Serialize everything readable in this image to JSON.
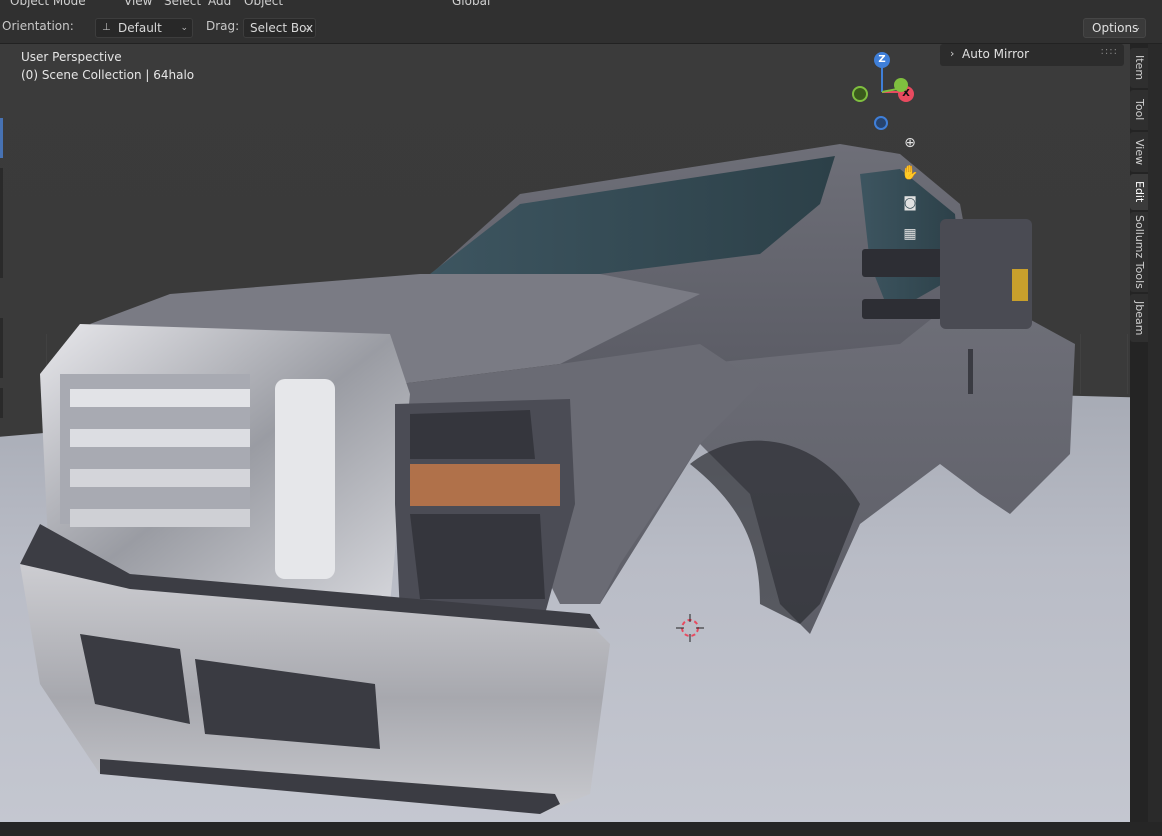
{
  "header": {
    "mode": "Object Mode",
    "menus": [
      "View",
      "Select",
      "Add",
      "Object"
    ],
    "transform_orientation": "Global"
  },
  "toolbar": {
    "orientation_label": "Orientation:",
    "orientation_value": "Default",
    "drag_label": "Drag:",
    "drag_value": "Select Box",
    "options_label": "Options"
  },
  "viewport": {
    "perspective": "User Perspective",
    "collection": "(0) Scene Collection | 64halo"
  },
  "gizmo": {
    "z": "Z",
    "x": "X"
  },
  "npanel": {
    "section": "Auto Mirror",
    "tabs": [
      "Item",
      "Tool",
      "View",
      "Edit",
      "Sollumz Tools",
      "Jbeam"
    ],
    "active_tab": "Edit"
  },
  "colors": {
    "x_axis": "#e84a5f",
    "y_axis": "#7fbf3f",
    "z_axis": "#3f7fd9",
    "active_accent": "#4772b3"
  },
  "icons": [
    "zoom-icon",
    "pan-hand-icon",
    "camera-icon",
    "grid-perspective-icon"
  ]
}
